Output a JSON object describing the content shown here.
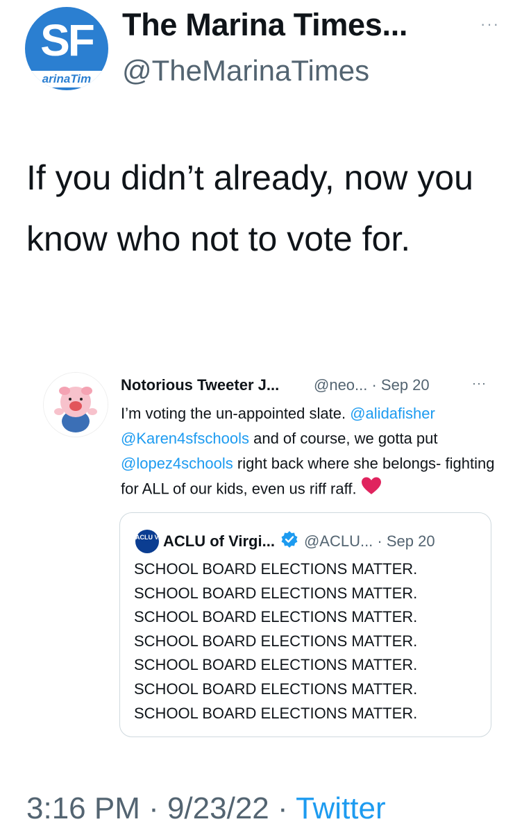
{
  "tweet": {
    "avatar_text": "SF",
    "avatar_band": "arinaTim",
    "display_name": "The Marina Times...",
    "handle": "@TheMarinaTimes",
    "more": "···",
    "text": "If you didn’t already, now you know who not to vote for."
  },
  "quoted": {
    "name": "Notorious Tweeter J...",
    "meta": "@neo... · Sep 20",
    "more": "···",
    "text": {
      "part1": "I’m voting the un-appointed slate. ",
      "mention1": "@alidafisher",
      "mention2": "@Karen4sfschools",
      "part2": " and of course, we gotta put ",
      "mention3": "@lopez4schools",
      "part3": " right back where she belongs- fighting for ALL of our kids, even us riff raff."
    },
    "heart_icon": "heart-icon",
    "heart_color": "#e0245e"
  },
  "nested_quote": {
    "logo_text": "ACLU VA",
    "name": "ACLU of Virgi...",
    "verified_color": "#1d9bf0",
    "meta": "@ACLU... · Sep 20",
    "lines": [
      "SCHOOL BOARD ELECTIONS MATTER.",
      "SCHOOL BOARD ELECTIONS MATTER.",
      "SCHOOL BOARD ELECTIONS MATTER.",
      "SCHOOL BOARD ELECTIONS MATTER.",
      "SCHOOL BOARD ELECTIONS MATTER.",
      "SCHOOL BOARD ELECTIONS MATTER.",
      "SCHOOL BOARD ELECTIONS MATTER."
    ]
  },
  "footer": {
    "time": "3:16 PM · 9/23/22 · ",
    "source": "Twitter"
  },
  "colors": {
    "link": "#1d9bf0",
    "secondary_text": "#536471",
    "brand_blue": "#2b7fd1"
  }
}
